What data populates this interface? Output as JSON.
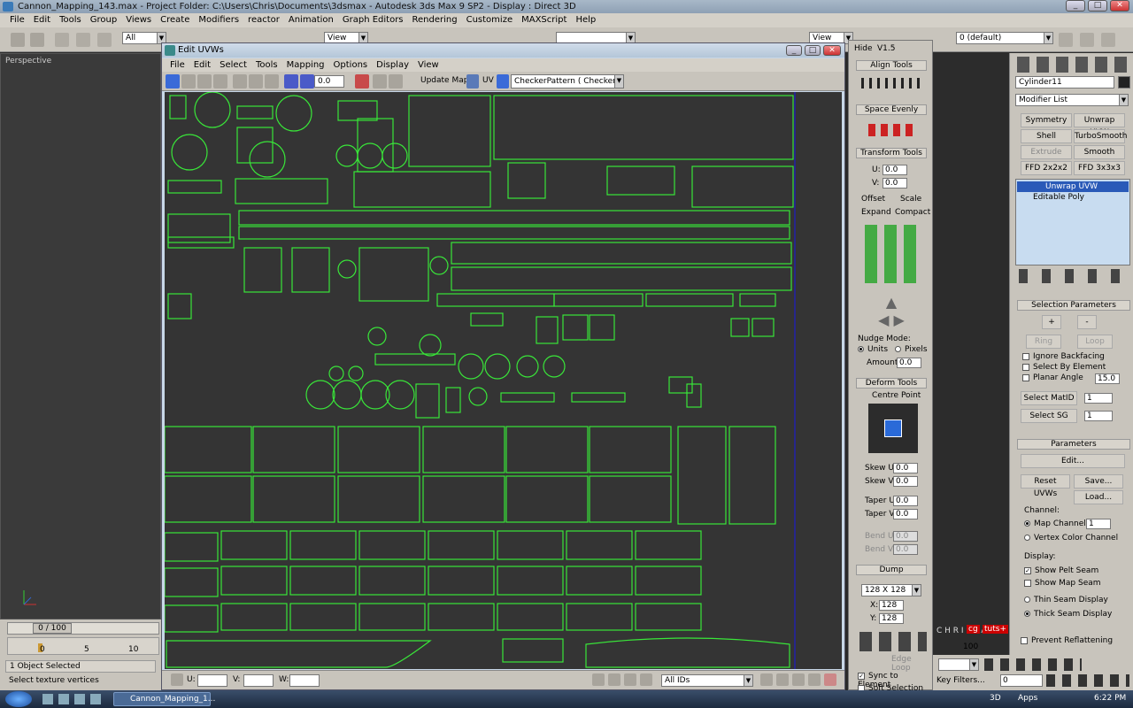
{
  "window": {
    "title": "Cannon_Mapping_143.max    - Project Folder: C:\\Users\\Chris\\Documents\\3dsmax    - Autodesk 3ds Max 9 SP2    - Display : Direct 3D"
  },
  "menubar": [
    "File",
    "Edit",
    "Tools",
    "Group",
    "Views",
    "Create",
    "Modifiers",
    "reactor",
    "Animation",
    "Graph Editors",
    "Rendering",
    "Customize",
    "MAXScript",
    "Help"
  ],
  "toolbar": {
    "selection_filter": "All",
    "view1": "View",
    "view2": "View",
    "layer": "0 (default)"
  },
  "viewport": {
    "label": "Perspective"
  },
  "timeline": {
    "frame": "0 / 100",
    "ticks": [
      "0",
      "5",
      "10"
    ]
  },
  "status": {
    "selected": "1 Object Selected",
    "prompt": "Select texture vertices"
  },
  "uvw": {
    "title": "Edit UVWs",
    "menu": [
      "File",
      "Edit",
      "Select",
      "Tools",
      "Mapping",
      "Options",
      "Display",
      "View"
    ],
    "spin_value": "0.0",
    "update_map": "Update Map",
    "uv_label": "UV",
    "checker": "CheckerPattern  ( Checker )",
    "bottom": {
      "u": "U:",
      "v": "V:",
      "w": "W:",
      "ids": "All IDs"
    }
  },
  "uvtools": {
    "hide": "Hide",
    "version": "V1.5",
    "align": "Align Tools",
    "space": "Space Evenly",
    "transform": "Transform Tools",
    "u": "U:",
    "v": "V:",
    "u_val": "0.0",
    "v_val": "0.0",
    "offset": "Offset",
    "scale": "Scale",
    "expand": "Expand",
    "compact": "Compact",
    "nudge": "Nudge Mode:",
    "units": "Units",
    "pixels": "Pixels",
    "amount": "Amount:",
    "amount_val": "0.0",
    "deform": "Deform Tools",
    "centre": "Centre Point",
    "skew_u": "Skew U",
    "skew_v": "Skew V",
    "taper_u": "Taper U",
    "taper_v": "Taper V",
    "bend_u": "Bend U",
    "bend_v": "Bend V",
    "zero": "0.0",
    "dump": "Dump",
    "size": "128 X 128",
    "x": "X:",
    "y": "Y:",
    "x_val": "128",
    "y_val": "128",
    "edge_loop": "Edge Loop",
    "sync": "Sync to Element",
    "soft_sel": "Soft Selection"
  },
  "cmd": {
    "object_name": "Cylinder11",
    "modifier_list": "Modifier List",
    "buttons": [
      "Symmetry",
      "Unwrap UVW",
      "Shell",
      "TurboSmooth",
      "Extrude",
      "Smooth",
      "FFD 2x2x2",
      "FFD 3x3x3"
    ],
    "stack": [
      "Unwrap UVW",
      "Editable Poly"
    ],
    "sel_params": "Selection Parameters",
    "plus": "+",
    "minus": "-",
    "ring": "Ring",
    "loop": "Loop",
    "ignore": "Ignore Backfacing",
    "by_element": "Select By Element",
    "planar": "Planar Angle",
    "planar_val": "15.0",
    "select_matid": "Select MatID",
    "select_sg": "Select SG",
    "one": "1",
    "params": "Parameters",
    "edit": "Edit...",
    "reset": "Reset UVWs",
    "save": "Save...",
    "load": "Load...",
    "channel": "Channel:",
    "map_channel": "Map Channel:",
    "vertex_color": "Vertex Color Channel",
    "display": "Display:",
    "show_pelt": "Show Pelt Seam",
    "show_map": "Show Map Seam",
    "thin": "Thin Seam Display",
    "thick": "Thick Seam Display",
    "prevent": "Prevent Reflattening"
  },
  "right": {
    "watermark": "C H R I S T A T E",
    "brand1": "cg",
    "brand2": "tuts+",
    "filters": "Key Filters...",
    "frame": "0",
    "num": "100"
  },
  "taskbar": {
    "task": "Cannon_Mapping_1...",
    "mode": "3D",
    "apps": "Apps",
    "time": "6:22 PM"
  },
  "colors": {
    "uv_line": "#c8c8c8",
    "uv_border": "#39e639",
    "canvas": "#343434",
    "accent": "#2a6ad8"
  }
}
